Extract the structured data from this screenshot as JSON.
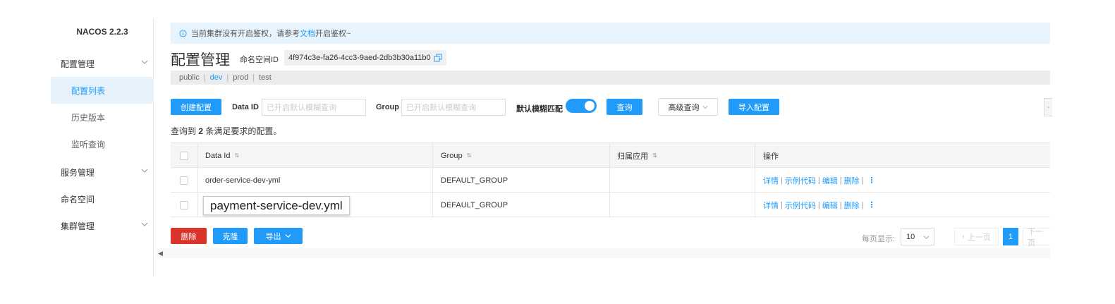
{
  "app": {
    "logo": "NACOS 2.2.3"
  },
  "sidebar": {
    "groups": [
      {
        "label": "配置管理"
      },
      {
        "label": "服务管理"
      },
      {
        "label": "命名空间"
      },
      {
        "label": "集群管理"
      }
    ],
    "sub_items": [
      {
        "label": "配置列表"
      },
      {
        "label": "历史版本"
      },
      {
        "label": "监听查询"
      }
    ]
  },
  "notice": {
    "text_before": "当前集群没有开启鉴权，请参考",
    "link": "文档",
    "text_after": "开启鉴权~"
  },
  "header": {
    "title": "配置管理",
    "namespace_label": "命名空间ID",
    "namespace_id": "4f974c3e-fa26-4cc3-9aed-2db3b30a11b0"
  },
  "namespaces": [
    {
      "label": "public"
    },
    {
      "label": "dev"
    },
    {
      "label": "prod"
    },
    {
      "label": "test"
    }
  ],
  "toolbar": {
    "create_label": "创建配置",
    "dataid_label": "Data ID",
    "dataid_placeholder": "已开启默认模糊查询",
    "group_label": "Group",
    "group_placeholder": "已开启默认模糊查询",
    "fuzzy_label": "默认模糊匹配",
    "fuzzy_on": true,
    "query_label": "查询",
    "advanced_label": "高级查询",
    "import_label": "导入配置",
    "edge_button": "-"
  },
  "result": {
    "prefix": "查询到",
    "count": "2",
    "suffix": "条满足要求的配置。"
  },
  "table": {
    "columns": [
      "Data Id",
      "Group",
      "归属应用",
      "操作"
    ],
    "rows": [
      {
        "data_id": "order-service-dev-yml",
        "group": "DEFAULT_GROUP",
        "app": ""
      },
      {
        "data_id": "payment-service-dev.yml",
        "group": "DEFAULT_GROUP",
        "app": ""
      }
    ],
    "ops": [
      "详情",
      "示例代码",
      "编辑",
      "删除"
    ],
    "more": "⋮"
  },
  "tooltip": "payment-service-dev.yml",
  "bottom": {
    "delete_label": "删除",
    "clone_label": "克隆",
    "export_label": "导出",
    "page_size_label": "每页显示:",
    "page_size": "10",
    "prev_label": "上一页",
    "current_page": "1",
    "next_label": "下一页"
  },
  "colors": {
    "primary": "#209bfa",
    "danger": "#d9352b"
  }
}
